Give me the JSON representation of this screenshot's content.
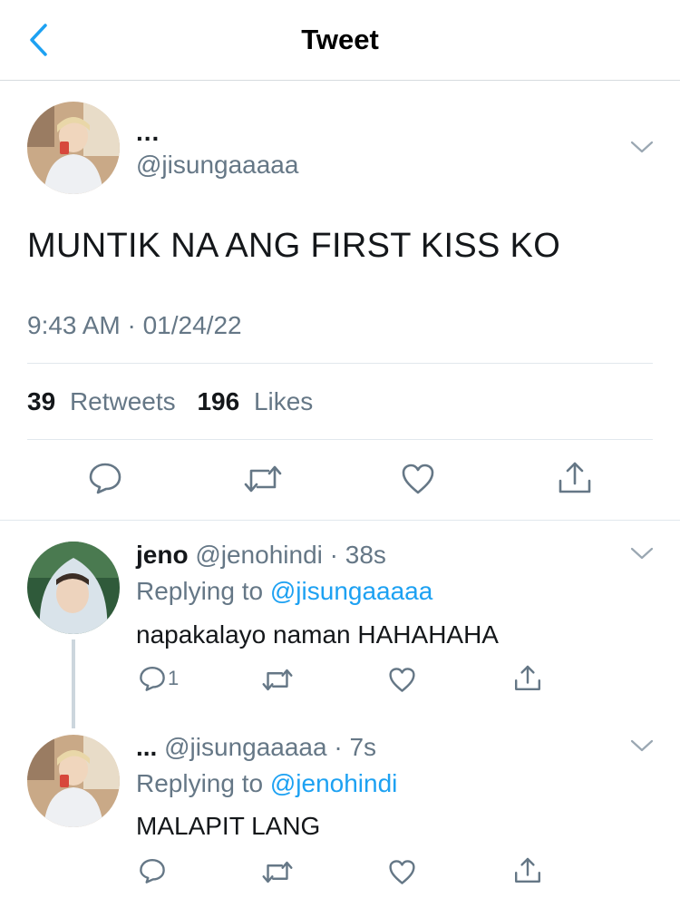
{
  "header": {
    "title": "Tweet",
    "back_icon": "chevron-left-icon"
  },
  "main_tweet": {
    "display_name": "...",
    "handle": "@jisungaaaaa",
    "text": "MUNTIK NA ANG FIRST KISS KO",
    "timestamp": "9:43 AM · 01/24/22",
    "retweets_count": "39",
    "retweets_label": "Retweets",
    "likes_count": "196",
    "likes_label": "Likes"
  },
  "replies": [
    {
      "display_name": "jeno",
      "handle": "@jenohindi",
      "time": "· 38s",
      "replying_label": "Replying to",
      "replying_to": "@jisungaaaaa",
      "text": "napakalayo naman HAHAHAHA",
      "reply_count": "1"
    },
    {
      "display_name": "...",
      "handle": "@jisungaaaaa",
      "time": "· 7s",
      "replying_label": "Replying to",
      "replying_to": "@jenohindi",
      "text": "MALAPIT LANG",
      "reply_count": ""
    }
  ],
  "colors": {
    "accent": "#1da1f2",
    "secondary_text": "#657786",
    "primary_text": "#14171a",
    "divider": "#e1e8ed"
  }
}
